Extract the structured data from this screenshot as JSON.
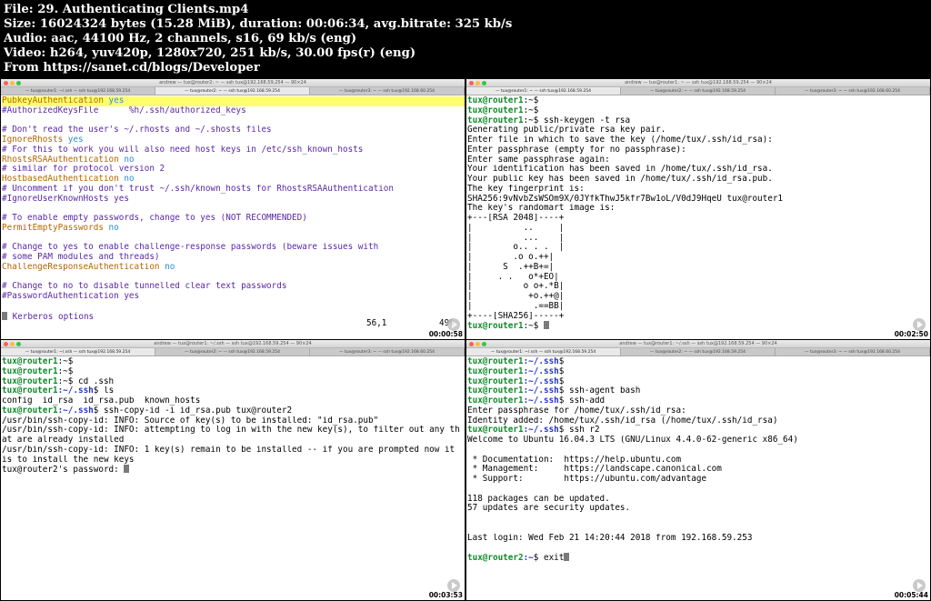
{
  "header": {
    "lines": [
      "File: 29. Authenticating Clients.mp4",
      "Size: 16024324 bytes (15.28 MiB), duration: 00:06:34, avg.bitrate: 325 kb/s",
      "Audio: aac, 44100 Hz, 2 channels, s16, 69 kb/s (eng)",
      "Video: h264, yuv420p, 1280x720, 251 kb/s, 30.00 fps(r) (eng)",
      "From https://sanet.cd/blogs/Developer"
    ]
  },
  "panels": {
    "p1": {
      "window_title": "andrew — tux@router2: ~ — ssh tux@192.168.59.254 — 90×24",
      "tabs": [
        "— tux@router1: ~/.ssh — ssh tux@192.168.59.254",
        "— tux@router2: ~ — ssh tux@192.168.59.254",
        "— tux@router3: ~ — ssh tux@192.168.60.254"
      ],
      "timestamp": "00:00:58",
      "status_pos": "56,1",
      "status_pct": "49%",
      "lines": {
        "l1a": "PubkeyAuthentication",
        "l1b": " yes",
        "l2": "#AuthorizedKeysFile      %h/.ssh/authorized_keys",
        "l3": "",
        "l4": "# Don't read the user's ~/.rhosts and ~/.shosts files",
        "l5a": "IgnoreRhosts",
        "l5b": " yes",
        "l6": "# For this to work you will also need host keys in /etc/ssh_known_hosts",
        "l7a": "RhostsRSAAuthentication",
        "l7b": " no",
        "l8": "# similar for protocol version 2",
        "l9a": "HostbasedAuthentication",
        "l9b": " no",
        "l10": "# Uncomment if you don't trust ~/.ssh/known_hosts for RhostsRSAAuthentication",
        "l11": "#IgnoreUserKnownHosts yes",
        "l12": "",
        "l13": "# To enable empty passwords, change to yes (NOT RECOMMENDED)",
        "l14a": "PermitEmptyPasswords",
        "l14b": " no",
        "l15": "",
        "l16": "# Change to yes to enable challenge-response passwords (beware issues with",
        "l17": "# some PAM modules and threads)",
        "l18a": "ChallengeResponseAuthentication",
        "l18b": " no",
        "l19": "",
        "l20": "# Change to no to disable tunnelled clear text passwords",
        "l21": "#PasswordAuthentication yes",
        "l22": "",
        "l23": " Kerberos options"
      }
    },
    "p2": {
      "window_title": "andrew — tux@router1: ~ — ssh tux@192.168.59.254 — 90×24",
      "tabs": [
        "— tux@router1: ~ — ssh tux@192.168.59.254",
        "— tux@router2: ~ — ssh tux@192.168.59.254",
        "— tux@router3: ~ — ssh tux@192.168.60.254"
      ],
      "timestamp": "00:02:50",
      "prompt_user": "tux@router1",
      "prompt_path_home": ":~$",
      "cmd_keygen": " ssh-keygen -t rsa",
      "out": [
        "Generating public/private rsa key pair.",
        "Enter file in which to save the key (/home/tux/.ssh/id_rsa):",
        "Enter passphrase (empty for no passphrase):",
        "Enter same passphrase again:",
        "Your identification has been saved in /home/tux/.ssh/id_rsa.",
        "Your public key has been saved in /home/tux/.ssh/id_rsa.pub.",
        "The key fingerprint is:",
        "SHA256:9vNvbZsWSOm9X/0JYfkThwJ5kfr7Bw1oL/V0dJ9HqeU tux@router1",
        "The key's randomart image is:",
        "+---[RSA 2048]----+",
        "|          ..     |",
        "|          ...    |",
        "|        o.. . .  |",
        "|        .o o.++| ",
        "|      S  .++B+=| ",
        "|     . .   o*+EO|",
        "|          o o+.*B|",
        "|           +o.++@|",
        "|            .==BB|",
        "+----[SHA256]-----+"
      ]
    },
    "p3": {
      "window_title": "andrew — tux@router1: ~/.ssh — ssh tux@192.168.59.254 — 90×24",
      "tabs": [
        "— tux@router1: ~/.ssh — ssh tux@192.168.59.254",
        "— tux@router2: ~ — ssh tux@192.168.59.254",
        "— tux@router3: ~ — ssh tux@192.168.60.254"
      ],
      "timestamp": "00:03:53",
      "prompt_user": "tux@router1",
      "path_home": ":~$",
      "path_ssh": ":~/.ssh",
      "dollar": "$",
      "cmd_cd": " cd .ssh",
      "cmd_ls": " ls",
      "ls_out": "config  id_rsa  id_rsa.pub  known_hosts",
      "cmd_copy": " ssh-copy-id -i id_rsa.pub tux@router2",
      "out": [
        "/usr/bin/ssh-copy-id: INFO: Source of key(s) to be installed: \"id_rsa.pub\"",
        "/usr/bin/ssh-copy-id: INFO: attempting to log in with the new key(s), to filter out any th",
        "at are already installed",
        "/usr/bin/ssh-copy-id: INFO: 1 key(s) remain to be installed -- if you are prompted now it",
        "is to install the new keys",
        "tux@router2's password: "
      ]
    },
    "p4": {
      "window_title": "andrew — tux@router1: ~/.ssh — ssh tux@192.168.59.254 — 90×24",
      "tabs": [
        "— tux@router1: ~/.ssh — ssh tux@192.168.59.254",
        "— tux@router2: ~ — ssh tux@192.168.59.254",
        "— tux@router3: ~ — ssh tux@192.168.60.254"
      ],
      "timestamp": "00:05:44",
      "prompt_user": "tux@router1",
      "prompt_user2": "tux@router2",
      "path_ssh": ":~/.ssh",
      "path_home": ":~",
      "dollar": "$",
      "cmd_agent": " ssh-agent bash",
      "cmd_add": " ssh-add",
      "out_add": [
        "Enter passphrase for /home/tux/.ssh/id_rsa:",
        "Identity added: /home/tux/.ssh/id_rsa (/home/tux/.ssh/id_rsa)"
      ],
      "cmd_ssh": " ssh r2",
      "welcome": [
        "Welcome to Ubuntu 16.04.3 LTS (GNU/Linux 4.4.0-62-generic x86_64)",
        "",
        " * Documentation:  https://help.ubuntu.com",
        " * Management:     https://landscape.canonical.com",
        " * Support:        https://ubuntu.com/advantage",
        "",
        "118 packages can be updated.",
        "57 updates are security updates.",
        "",
        "",
        "Last login: Wed Feb 21 14:20:44 2018 from 192.168.59.253"
      ],
      "cmd_exit": " exit"
    }
  }
}
